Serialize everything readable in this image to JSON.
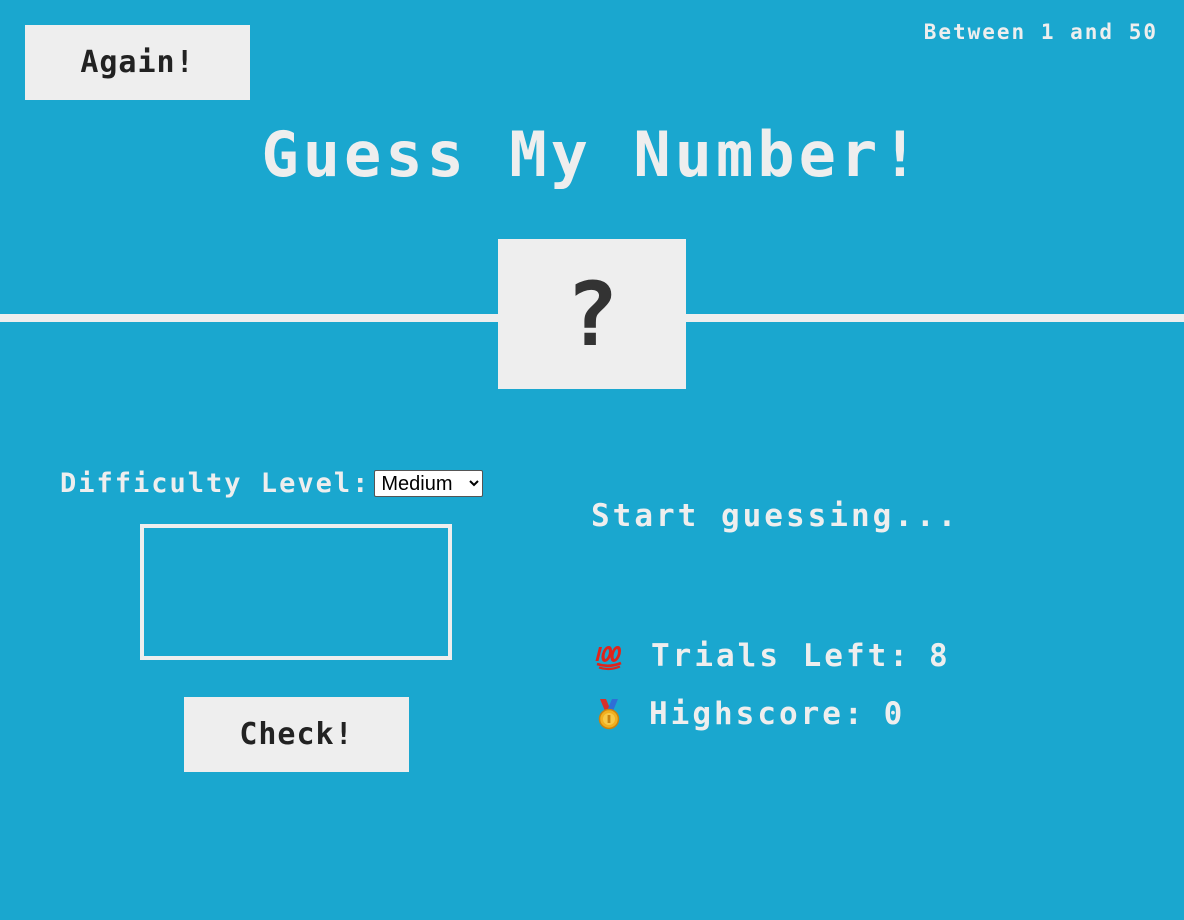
{
  "header": {
    "again_label": "Again!",
    "range_text": "Between 1 and 50"
  },
  "title": "Guess My Number!",
  "secret_number_display": "?",
  "difficulty": {
    "label": "Difficulty Level:",
    "selected": "Medium",
    "options": [
      "Medium"
    ]
  },
  "guess_input": {
    "value": ""
  },
  "check_label": "Check!",
  "message": "Start guessing...",
  "stats": {
    "trials_icon": "hundred-points-icon",
    "trials_label": "Trials Left:",
    "trials_value": "8",
    "highscore_icon": "medal-icon",
    "highscore_label": "Highscore:",
    "highscore_value": "0"
  },
  "colors": {
    "background": "#1aa7cf",
    "foreground": "#eeeeee",
    "button_text": "#222222"
  }
}
